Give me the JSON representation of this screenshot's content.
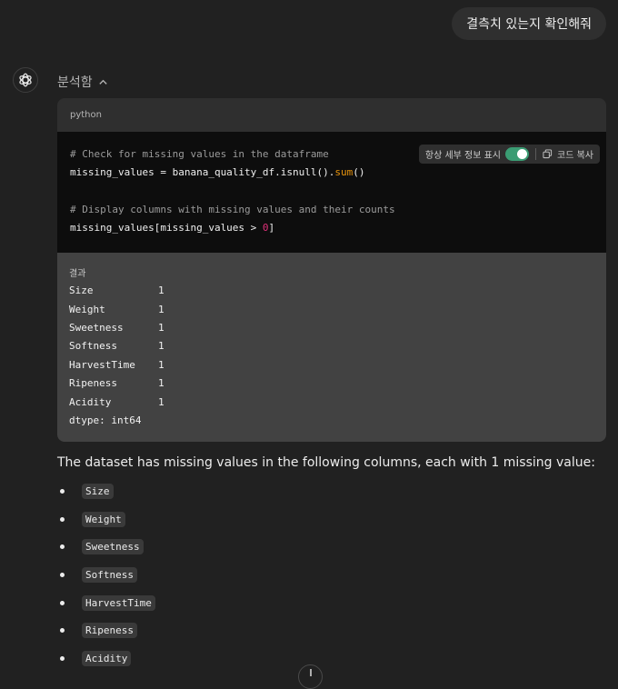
{
  "user_message": "결측치 있는지 확인해줘",
  "assistant": {
    "analysis_toggle_label": "분석함",
    "code_language": "python",
    "toolbar": {
      "always_show_details_label": "항상 세부 정보 표시",
      "copy_code_label": "코드 복사"
    },
    "code": {
      "line1_comment": "# Check for missing values in the dataframe",
      "line2_prefix": "missing_values = banana_quality_df.isnull().",
      "line2_fn": "sum",
      "line2_suffix": "()",
      "line4_comment": "# Display columns with missing values and their counts",
      "line5_prefix": "missing_values[missing_values > ",
      "line5_num": "0",
      "line5_suffix": "]"
    },
    "result_label": "결과",
    "result_rows": [
      {
        "name": "Size",
        "value": "1"
      },
      {
        "name": "Weight",
        "value": "1"
      },
      {
        "name": "Sweetness",
        "value": "1"
      },
      {
        "name": "Softness",
        "value": "1"
      },
      {
        "name": "HarvestTime",
        "value": "1"
      },
      {
        "name": "Ripeness",
        "value": "1"
      },
      {
        "name": "Acidity",
        "value": "1"
      }
    ],
    "dtype_line": "dtype: int64",
    "summary_text": "The dataset has missing values in the following columns, each with 1 missing value:",
    "bullets": [
      "Size",
      "Weight",
      "Sweetness",
      "Softness",
      "HarvestTime",
      "Ripeness",
      "Acidity"
    ]
  },
  "colors": {
    "background": "#212121",
    "toggle_on": "#3a9c73"
  },
  "icons": [
    "openai-logo-icon",
    "chevron-up-icon",
    "copy-icon",
    "arrow-down-icon"
  ]
}
